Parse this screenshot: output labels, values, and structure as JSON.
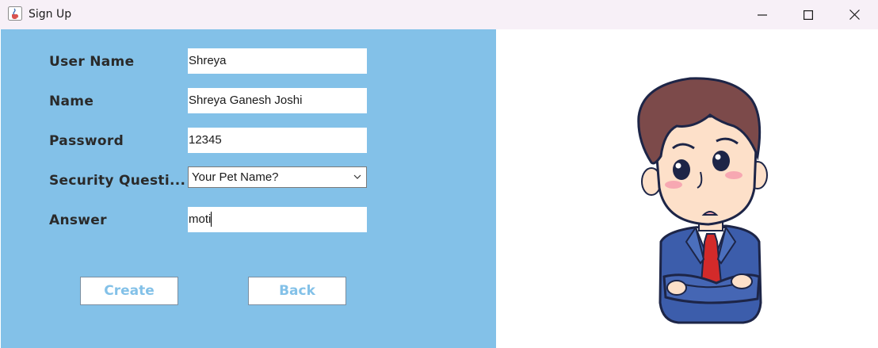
{
  "window": {
    "title": "Sign Up",
    "icon": "java-cup-icon"
  },
  "form": {
    "username_label": "User Name",
    "username_value": "Shreya",
    "name_label": "Name",
    "name_value": "Shreya Ganesh Joshi",
    "password_label": "Password",
    "password_value": "12345",
    "security_label": "Security Questi...",
    "security_selected": "Your Pet Name?",
    "answer_label": "Answer",
    "answer_value": "moti"
  },
  "buttons": {
    "create_label": "Create",
    "back_label": "Back"
  },
  "colors": {
    "panel_bg": "#83c1e8",
    "button_text": "#83c1e8"
  },
  "illustration": {
    "icon": "confused-boy-cartoon"
  }
}
